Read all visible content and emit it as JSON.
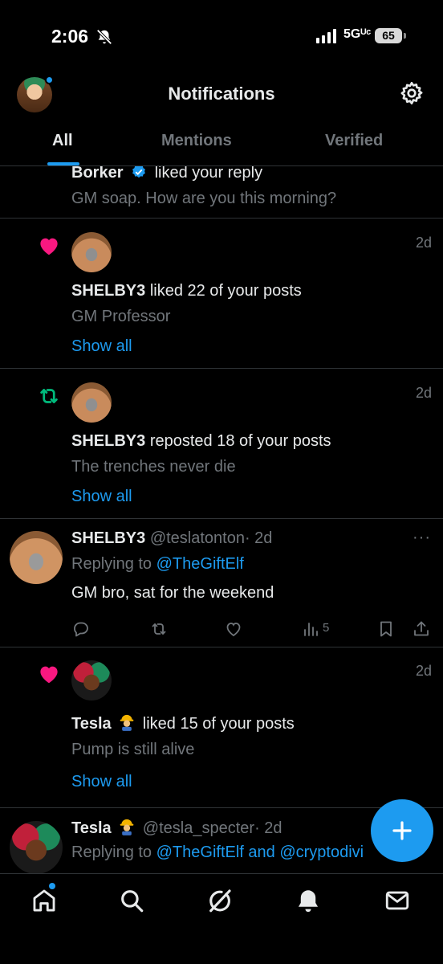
{
  "status_bar": {
    "time": "2:06",
    "network": "5Gᵁᶜ",
    "battery": "65"
  },
  "header": {
    "title": "Notifications",
    "tabs": [
      {
        "label": "All",
        "active": true
      },
      {
        "label": "Mentions",
        "active": false
      },
      {
        "label": "Verified",
        "active": false
      }
    ]
  },
  "feed": {
    "item0": {
      "actor": "Borker",
      "action": "liked your reply",
      "snippet": "GM soap. How are you this morning?"
    },
    "item1": {
      "type_icon": "heart-icon",
      "time": "2d",
      "actor": "SHELBY3",
      "action": "liked 22 of your posts",
      "snippet": "GM Professor",
      "show_all": "Show all"
    },
    "item2": {
      "type_icon": "repost-icon",
      "time": "2d",
      "actor": "SHELBY3",
      "action": "reposted 18 of your posts",
      "snippet": "The trenches never die",
      "show_all": "Show all"
    },
    "item3": {
      "name": "SHELBY3",
      "handle": "@teslatonton",
      "time": "· 2d",
      "replying_prefix": "Replying to",
      "replying_to": "@TheGiftElf",
      "text": "GM bro, sat for the weekend",
      "views": "5"
    },
    "item4": {
      "type_icon": "heart-icon",
      "time": "2d",
      "actor": "Tesla",
      "action": "liked 15 of your posts",
      "snippet": "Pump is still alive",
      "show_all": "Show all"
    },
    "item5": {
      "name": "Tesla",
      "handle": "@tesla_specter",
      "time": "· 2d",
      "replying_prefix": "Replying to",
      "replying_to": "@TheGiftElf and @cryptodivi"
    }
  },
  "colors": {
    "accent": "#1d9bf0",
    "like": "#f91880",
    "repost": "#00ba7c",
    "muted": "#71767b",
    "text": "#e7e9ea"
  }
}
